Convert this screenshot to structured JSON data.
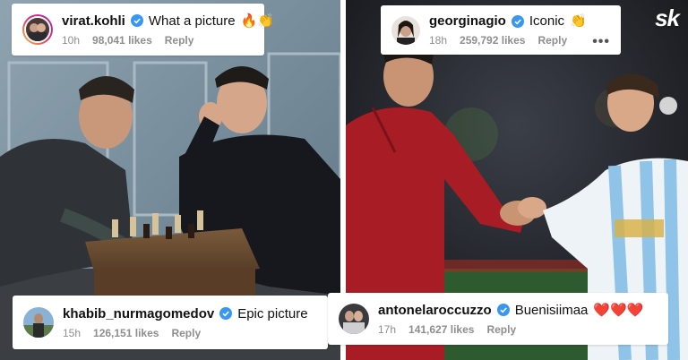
{
  "brand_logo": "sk",
  "comments": [
    {
      "username": "virat.kohli",
      "text": "What a picture",
      "emoji": "🔥👏",
      "time": "10h",
      "likes": "98,041 likes",
      "reply": "Reply"
    },
    {
      "username": "georginagio",
      "text": "Iconic",
      "emoji": "👏",
      "time": "18h",
      "likes": "259,792 likes",
      "reply": "Reply",
      "more": "•••"
    },
    {
      "username": "khabib_nurmagomedov",
      "text": "Epic picture",
      "emoji": "",
      "time": "15h",
      "likes": "126,151 likes",
      "reply": "Reply"
    },
    {
      "username": "antonelaroccuzzo",
      "text": "Buenisiimaa",
      "emoji": "❤️❤️❤️",
      "time": "17h",
      "likes": "141,627 likes",
      "reply": "Reply"
    }
  ],
  "colors": {
    "verified": "#3897f0",
    "jersey_red": "#a81c25",
    "stadium_dark": "#1c1d22"
  }
}
